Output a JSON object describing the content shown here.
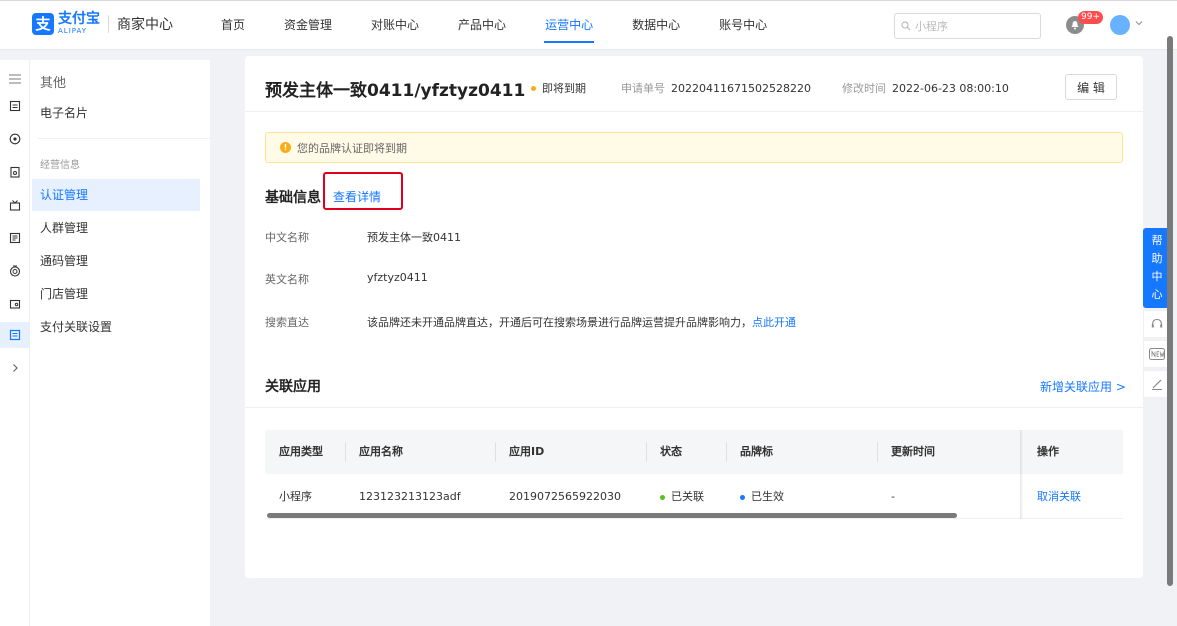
{
  "brand": {
    "logo_glyph": "支",
    "name_cn": "支付宝",
    "name_en": "ALIPAY",
    "product": "商家中心"
  },
  "nav": {
    "items": [
      "首页",
      "资金管理",
      "对账中心",
      "产品中心",
      "运营中心",
      "数据中心",
      "账号中心"
    ],
    "active": "运营中心"
  },
  "search": {
    "placeholder": "小程序"
  },
  "notifications": {
    "badge": "99+"
  },
  "submenu": {
    "group_title": "其他",
    "card_item": "电子名片",
    "section_label": "经营信息",
    "items": [
      "认证管理",
      "人群管理",
      "通码管理",
      "门店管理",
      "支付关联设置"
    ],
    "active": "认证管理"
  },
  "header": {
    "title": "预发主体一致0411/yfztyz0411",
    "status": "即将到期",
    "status_color": "#faad14",
    "apply_no_label": "申请单号",
    "apply_no": "20220411671502528220",
    "modified_label": "修改时间",
    "modified_time": "2022-06-23 08:00:10",
    "edit_label": "编 辑"
  },
  "alert": {
    "icon": "!",
    "text": "您的品牌认证即将到期"
  },
  "basic_info": {
    "title": "基础信息",
    "detail_link": "查看详情",
    "fields": [
      {
        "label": "中文名称",
        "value": "预发主体一致0411"
      },
      {
        "label": "英文名称",
        "value": "yfztyz0411"
      },
      {
        "label": "搜索直达",
        "value": "该品牌还未开通品牌直达，开通后可在搜索场景进行品牌运营提升品牌影响力，",
        "link": "点此开通"
      }
    ]
  },
  "related_apps": {
    "title": "关联应用",
    "add_link": "新增关联应用 >",
    "columns": [
      "应用类型",
      "应用名称",
      "应用ID",
      "状态",
      "品牌标",
      "更新时间",
      "操作"
    ],
    "rows": [
      {
        "type": "小程序",
        "name": "123123213123adf",
        "app_id": "2019072565922030",
        "status": "已关联",
        "status_color": "#52c41a",
        "brand_mark": "已生效",
        "brand_mark_color": "#1677ff",
        "updated": "-",
        "action": "取消关联"
      }
    ]
  },
  "help": {
    "chars": [
      "帮",
      "助",
      "中",
      "心"
    ]
  },
  "colors": {
    "accent": "#1677ff",
    "highlight": "#e0001b"
  }
}
